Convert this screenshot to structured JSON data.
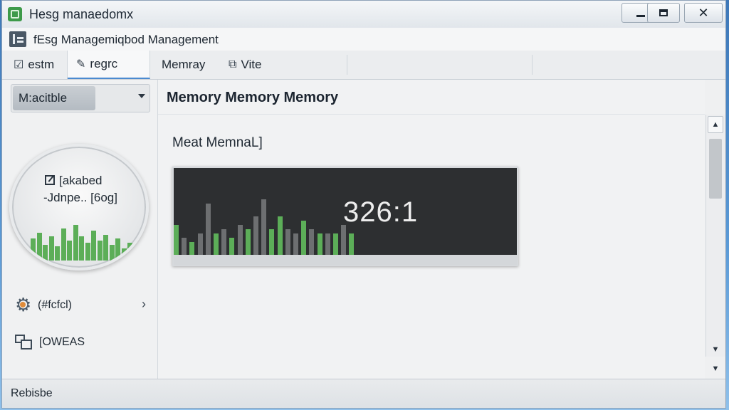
{
  "window": {
    "title": "Hesg manaedomx",
    "minimize_icon": "minimize-icon",
    "maximize_icon": "maximize-icon",
    "close_glyph": "✕"
  },
  "app": {
    "title": "fEsg Managemiqbod Management"
  },
  "tabs": [
    {
      "label": "estm",
      "icon": "☑"
    },
    {
      "label": "regrc",
      "icon": "✎"
    },
    {
      "label": "Memray",
      "icon": ""
    },
    {
      "label": "Vite",
      "icon": "⧉"
    }
  ],
  "sidebar": {
    "select_value": "M:acitble",
    "gauge": {
      "line1": "[akabed",
      "line2": "-Jdnpe.. [6og]",
      "bars": [
        0.55,
        0.7,
        0.4,
        0.6,
        0.35,
        0.8,
        0.5,
        0.9,
        0.6,
        0.45,
        0.75,
        0.5,
        0.65,
        0.4,
        0.55,
        0.3,
        0.45,
        0.25
      ]
    },
    "items": [
      {
        "label": "(#fcfcl)",
        "icon": "gear-icon",
        "chevron": "›"
      },
      {
        "label": "[OWEAS",
        "icon": "windows-icon"
      }
    ]
  },
  "main": {
    "title": "Memory Memory Memory",
    "sub_label": "Meat MemnaL]",
    "readout": "326:1",
    "bars": [
      {
        "v": 0.35,
        "c": "#5cae58"
      },
      {
        "v": 0.2,
        "c": "#6d6f71"
      },
      {
        "v": 0.15,
        "c": "#5cae58"
      },
      {
        "v": 0.25,
        "c": "#6d6f71"
      },
      {
        "v": 0.6,
        "c": "#6d6f71"
      },
      {
        "v": 0.25,
        "c": "#5cae58"
      },
      {
        "v": 0.3,
        "c": "#6d6f71"
      },
      {
        "v": 0.2,
        "c": "#5cae58"
      },
      {
        "v": 0.35,
        "c": "#6d6f71"
      },
      {
        "v": 0.3,
        "c": "#5cae58"
      },
      {
        "v": 0.45,
        "c": "#6d6f71"
      },
      {
        "v": 0.65,
        "c": "#6d6f71"
      },
      {
        "v": 0.3,
        "c": "#5cae58"
      },
      {
        "v": 0.45,
        "c": "#5cae58"
      },
      {
        "v": 0.3,
        "c": "#6d6f71"
      },
      {
        "v": 0.25,
        "c": "#6d6f71"
      },
      {
        "v": 0.4,
        "c": "#5cae58"
      },
      {
        "v": 0.3,
        "c": "#6d6f71"
      },
      {
        "v": 0.25,
        "c": "#5cae58"
      },
      {
        "v": 0.25,
        "c": "#6d6f71"
      },
      {
        "v": 0.25,
        "c": "#5cae58"
      },
      {
        "v": 0.35,
        "c": "#6d6f71"
      },
      {
        "v": 0.25,
        "c": "#5cae58"
      }
    ]
  },
  "scrollbar": {
    "up_glyph": "▲",
    "down_glyph": "▼"
  },
  "status": {
    "text": "Rebisbe"
  },
  "colors": {
    "accent": "#4a8ad0",
    "bar_green": "#5cae58",
    "panel_bg": "#2d2f31"
  }
}
